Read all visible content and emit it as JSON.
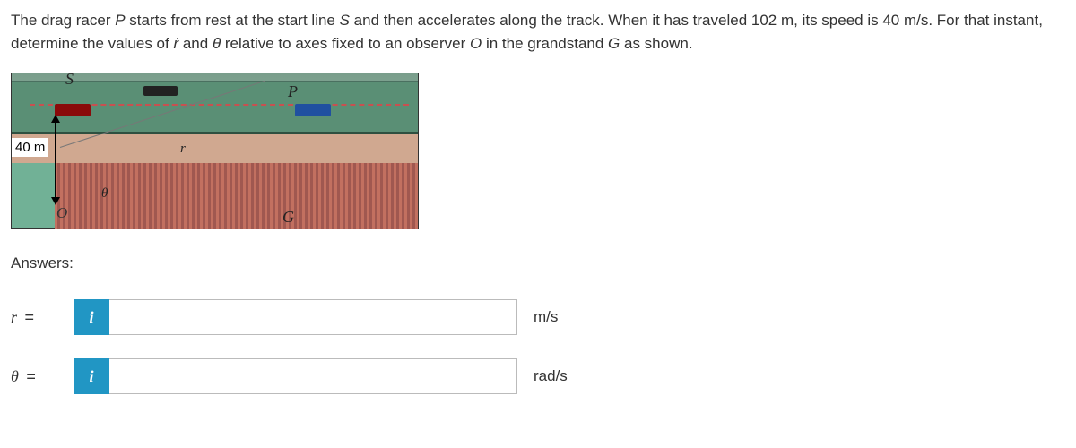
{
  "problem": {
    "part1": "The drag racer ",
    "var_p": "P",
    "part2": " starts from rest at the start line ",
    "var_s": "S",
    "part3": " and then accelerates along the track. When it has traveled 102 m, its speed is 40 m/s. For that instant, determine the values of ",
    "var_rdot": "ṙ",
    "part4": " and ",
    "var_thetadot": "θ̇",
    "part5": " relative to axes fixed to an observer ",
    "var_o": "O",
    "part6": " in the grandstand ",
    "var_g": "G",
    "part7": " as shown."
  },
  "figure": {
    "label_s": "S",
    "label_p": "P",
    "label_g": "G",
    "label_o": "O",
    "label_r": "r",
    "label_theta": "θ",
    "distance": "40 m"
  },
  "answers": {
    "heading": "Answers:",
    "rdot": {
      "symbol": "r",
      "dot": ".",
      "equals": "=",
      "value": "",
      "unit": "m/s"
    },
    "thetadot": {
      "symbol": "θ",
      "dot": ".",
      "equals": "=",
      "value": "",
      "unit": "rad/s"
    },
    "info_icon": "i"
  }
}
